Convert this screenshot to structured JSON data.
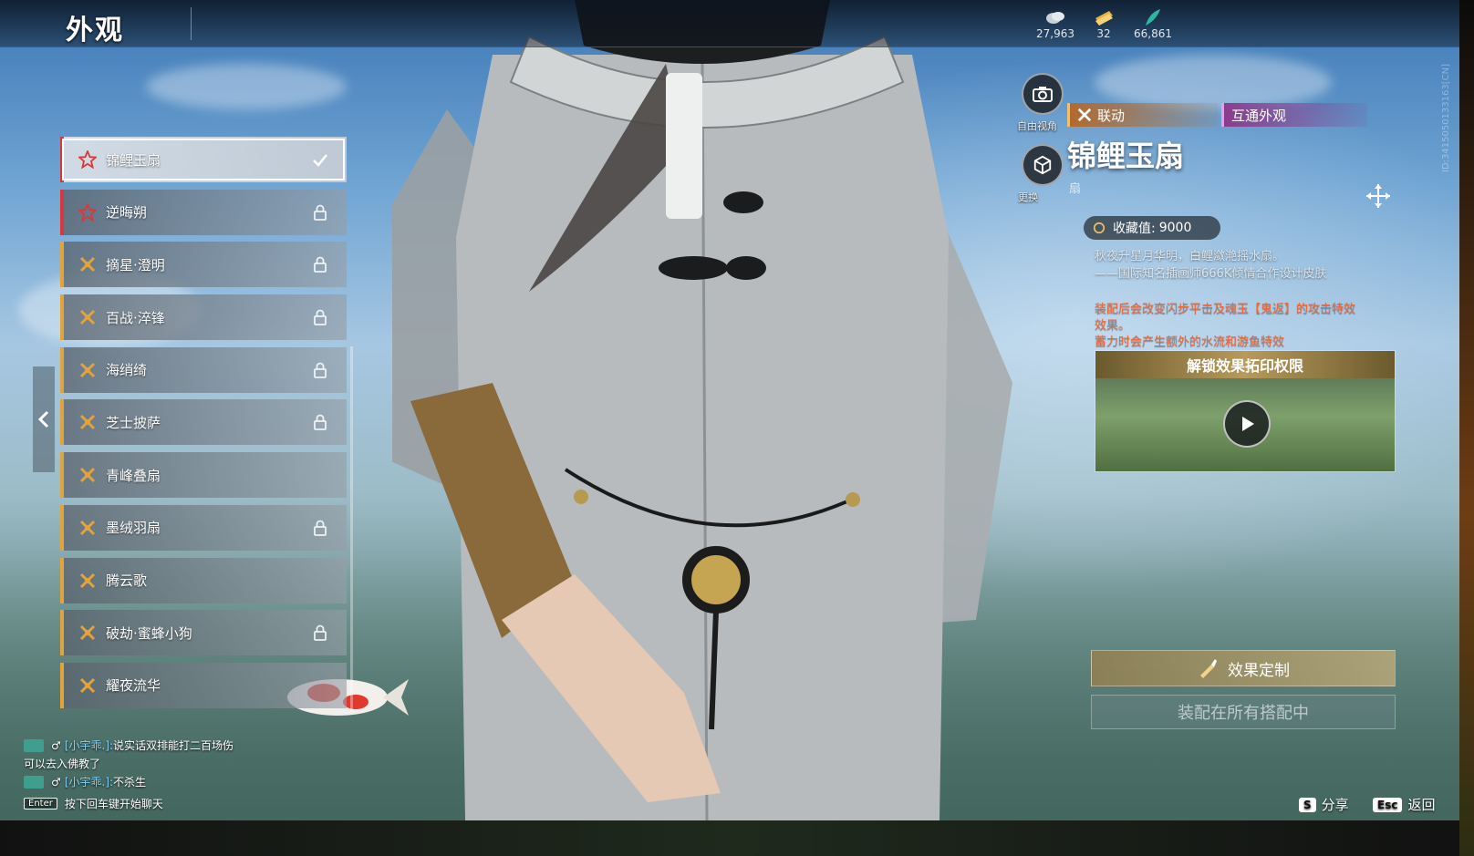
{
  "header": {
    "title": "外观",
    "currencies": [
      {
        "icon": "jade-coin-icon",
        "value": "27,963"
      },
      {
        "icon": "ticket-icon",
        "value": "32"
      },
      {
        "icon": "feather-icon",
        "value": "66,861"
      }
    ]
  },
  "outfits": [
    {
      "name": "锦鲤玉扇",
      "tier": "red",
      "state": "check",
      "selected": true
    },
    {
      "name": "逆晦朔",
      "tier": "red",
      "state": "lock"
    },
    {
      "name": "摘星·澄明",
      "tier": "gold",
      "state": "lock"
    },
    {
      "name": "百战·淬锋",
      "tier": "gold",
      "state": "lock"
    },
    {
      "name": "海绡绮",
      "tier": "gold",
      "state": "lock"
    },
    {
      "name": "芝士披萨",
      "tier": "gold",
      "state": "lock"
    },
    {
      "name": "青峰叠扇",
      "tier": "gold",
      "state": "none"
    },
    {
      "name": "墨绒羽扇",
      "tier": "gold",
      "state": "lock"
    },
    {
      "name": "腾云歌",
      "tier": "gold",
      "state": "none"
    },
    {
      "name": "破劫·蜜蜂小狗",
      "tier": "gold",
      "state": "lock"
    },
    {
      "name": "耀夜流华",
      "tier": "gold",
      "state": "none"
    }
  ],
  "tools": {
    "camera_label": "自由视角",
    "change_label": "更换"
  },
  "detail": {
    "tag_collab": "联动",
    "tag_cross": "互通外观",
    "title": "锦鲤玉扇",
    "slot": "扇",
    "collect_label": "收藏值:",
    "collect_value": "9000",
    "desc_lines": [
      "秋夜升星月华明，白鲤潋滟摇水扇。",
      "——国际知名插画师666K倾情合作设计皮肤"
    ],
    "effect_lines": [
      "装配后会改变闪步平击及魂玉【鬼返】的攻击特效",
      "效果。",
      "蓄力时会产生额外的水流和游鱼特效"
    ],
    "unlock_title": "解锁效果拓印权限",
    "customize_label": "效果定制",
    "equip_all_label": "装配在所有搭配中"
  },
  "chat": {
    "lines": [
      {
        "user": "[小宇乖.]:",
        "text": "说实话双排能打二百场伤"
      },
      {
        "user": "",
        "text": "可以去入佛教了"
      },
      {
        "user": "[小宇乖.]:",
        "text": "不杀生"
      }
    ],
    "enter_key": "Enter",
    "enter_hint": "按下回车键开始聊天"
  },
  "hints": {
    "share_key": "S",
    "share_label": "分享",
    "back_key": "Esc",
    "back_label": "返回"
  },
  "uid": "ID:3415050133163[CN]",
  "colors": {
    "tier_red": "#d9383a",
    "tier_gold": "#e2a23c",
    "effect_text": "#f0683a",
    "collab_tag": "#b26a2e",
    "cross_tag": "#8a3c8c"
  }
}
